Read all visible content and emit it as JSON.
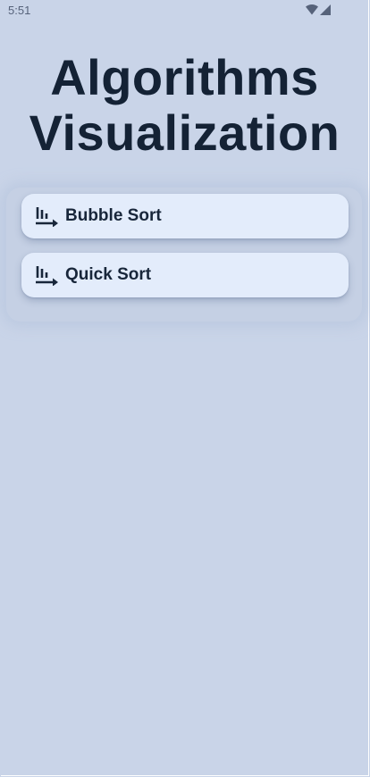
{
  "status_bar": {
    "time": "5:51",
    "icons": [
      "wifi-icon",
      "cellular-signal-icon"
    ]
  },
  "app": {
    "title_line1": "Algorithms",
    "title_line2": "Visualization"
  },
  "menu": {
    "items": [
      {
        "label": "Bubble Sort",
        "icon": "sort-chart-icon"
      },
      {
        "label": "Quick Sort",
        "icon": "sort-chart-icon"
      }
    ]
  },
  "colors": {
    "background": "#c9d4e8",
    "card": "#e3ecfb",
    "text": "#142235"
  }
}
